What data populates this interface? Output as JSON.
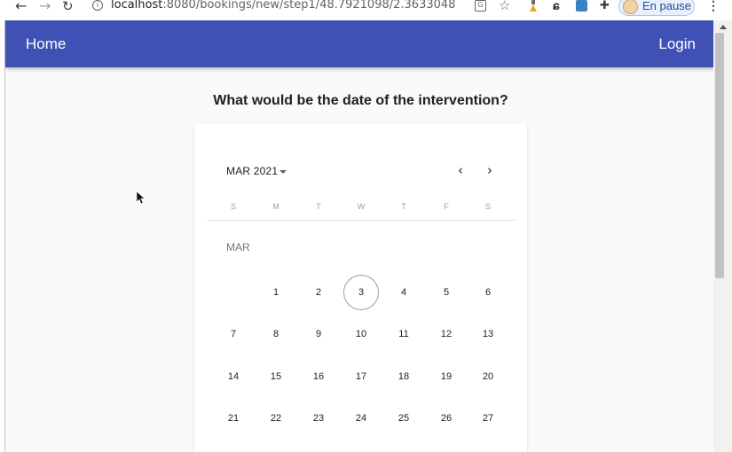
{
  "browser": {
    "url_host": "localhost",
    "url_path": ":8080/bookings/new/step1/48.7921098/2.3633048",
    "profile_label": "En pause",
    "icons": [
      "back-arrow-icon",
      "forward-arrow-icon",
      "reload-icon",
      "info-icon",
      "translate-icon",
      "star-icon",
      "flask-icon",
      "extension-c-icon",
      "extension-box-icon",
      "puzzle-icon",
      "kebab-menu-icon"
    ]
  },
  "appbar": {
    "home_label": "Home",
    "login_label": "Login",
    "color": "#3f51b5"
  },
  "page": {
    "question": "What would be the date of the intervention?"
  },
  "calendar": {
    "month_selector": "MAR 2021",
    "month_label": "MAR",
    "prev_icon": "chevron-left-icon",
    "next_icon": "chevron-right-icon",
    "weekdays": [
      "S",
      "M",
      "T",
      "W",
      "T",
      "F",
      "S"
    ],
    "today": "3",
    "weeks": [
      [
        "",
        "1",
        "2",
        "3",
        "4",
        "5",
        "6"
      ],
      [
        "7",
        "8",
        "9",
        "10",
        "11",
        "12",
        "13"
      ],
      [
        "14",
        "15",
        "16",
        "17",
        "18",
        "19",
        "20"
      ],
      [
        "21",
        "22",
        "23",
        "24",
        "25",
        "26",
        "27"
      ]
    ]
  }
}
